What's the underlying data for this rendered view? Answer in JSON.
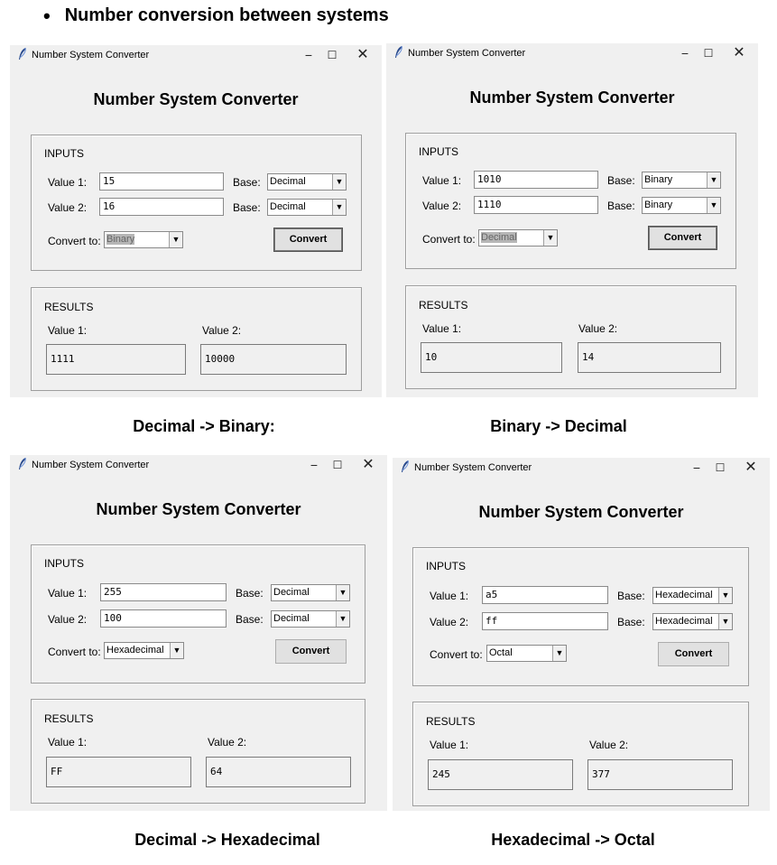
{
  "heading": {
    "bullet": "•",
    "text": "Number conversion between systems"
  },
  "windows": [
    {
      "window_title": "Number System Converter",
      "controls": {
        "minimize": "−",
        "maximize": "☐",
        "close": "✕"
      },
      "app_title": "Number System Converter",
      "inputs": {
        "label": "INPUTS",
        "value1_label": "Value 1:",
        "value1": "15",
        "value2_label": "Value 2:",
        "value2": "16",
        "base_label": "Base:",
        "base1": "Decimal",
        "base2": "Decimal",
        "convert_to_label": "Convert to:",
        "convert_to": "Binary",
        "convert_button": "Convert"
      },
      "results": {
        "label": "RESULTS",
        "value1_label": "Value 1:",
        "value2_label": "Value 2:",
        "value1": "1111",
        "value2": "10000"
      },
      "caption": "Decimal -> Binary:"
    },
    {
      "window_title": "Number System Converter",
      "controls": {
        "minimize": "−",
        "maximize": "☐",
        "close": "✕"
      },
      "app_title": "Number System Converter",
      "inputs": {
        "label": "INPUTS",
        "value1_label": "Value 1:",
        "value1": "1010",
        "value2_label": "Value 2:",
        "value2": "1110",
        "base_label": "Base:",
        "base1": "Binary",
        "base2": "Binary",
        "convert_to_label": "Convert to:",
        "convert_to": "Decimal",
        "convert_button": "Convert"
      },
      "results": {
        "label": "RESULTS",
        "value1_label": "Value 1:",
        "value2_label": "Value 2:",
        "value1": "10",
        "value2": "14"
      },
      "caption": "Binary -> Decimal"
    },
    {
      "window_title": "Number System Converter",
      "controls": {
        "minimize": "−",
        "maximize": "☐",
        "close": "✕"
      },
      "app_title": "Number System Converter",
      "inputs": {
        "label": "INPUTS",
        "value1_label": "Value 1:",
        "value1": "255",
        "value2_label": "Value 2:",
        "value2": "100",
        "base_label": "Base:",
        "base1": "Decimal",
        "base2": "Decimal",
        "convert_to_label": "Convert to:",
        "convert_to": "Hexadecimal",
        "convert_button": "Convert"
      },
      "results": {
        "label": "RESULTS",
        "value1_label": "Value 1:",
        "value2_label": "Value 2:",
        "value1": "FF",
        "value2": "64"
      },
      "caption": "Decimal -> Hexadecimal"
    },
    {
      "window_title": "Number System Converter",
      "controls": {
        "minimize": "−",
        "maximize": "☐",
        "close": "✕"
      },
      "app_title": "Number System Converter",
      "inputs": {
        "label": "INPUTS",
        "value1_label": "Value 1:",
        "value1": "a5",
        "value2_label": "Value 2:",
        "value2": "ff",
        "base_label": "Base:",
        "base1": "Hexadecimal",
        "base2": "Hexadecimal",
        "convert_to_label": "Convert to:",
        "convert_to": "Octal",
        "convert_button": "Convert"
      },
      "results": {
        "label": "RESULTS",
        "value1_label": "Value 1:",
        "value2_label": "Value 2:",
        "value1": "245",
        "value2": "377"
      },
      "caption": "Hexadecimal -> Octal"
    }
  ],
  "icons": {
    "window_icon": "feather-icon",
    "dropdown": "dropdown-arrow-icon"
  },
  "colors": {
    "window_bg": "#f0f0f0",
    "button_bg": "#e1e1e1",
    "selection": "#b6b6b6"
  }
}
